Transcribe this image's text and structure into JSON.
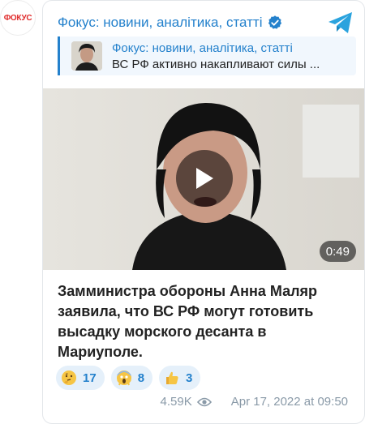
{
  "channel": {
    "avatar_text": "ФОКУС",
    "title": "Фокус: новини, аналітика, статті",
    "verified_icon": "verified-check-icon",
    "app_icon": "telegram-icon",
    "accent_color": "#2481cc"
  },
  "quote": {
    "title": "Фокус: новини, аналітика, статті",
    "text": "ВС РФ активно накапливают силы ..."
  },
  "video": {
    "duration": "0:49",
    "play_icon": "play-icon"
  },
  "message": {
    "lines": [
      "Замминистра обороны Анна Маляр",
      "заявила, что ВС РФ могут готовить",
      "высадку морского десанта в",
      "Мариуполе."
    ]
  },
  "reactions": [
    {
      "icon": "thinking-face-icon",
      "count": "17"
    },
    {
      "icon": "screaming-face-icon",
      "count": "8"
    },
    {
      "icon": "thumbs-up-icon",
      "count": "3"
    }
  ],
  "meta": {
    "views": "4.59K",
    "date": "Apr 17, 2022 at 09:50"
  }
}
